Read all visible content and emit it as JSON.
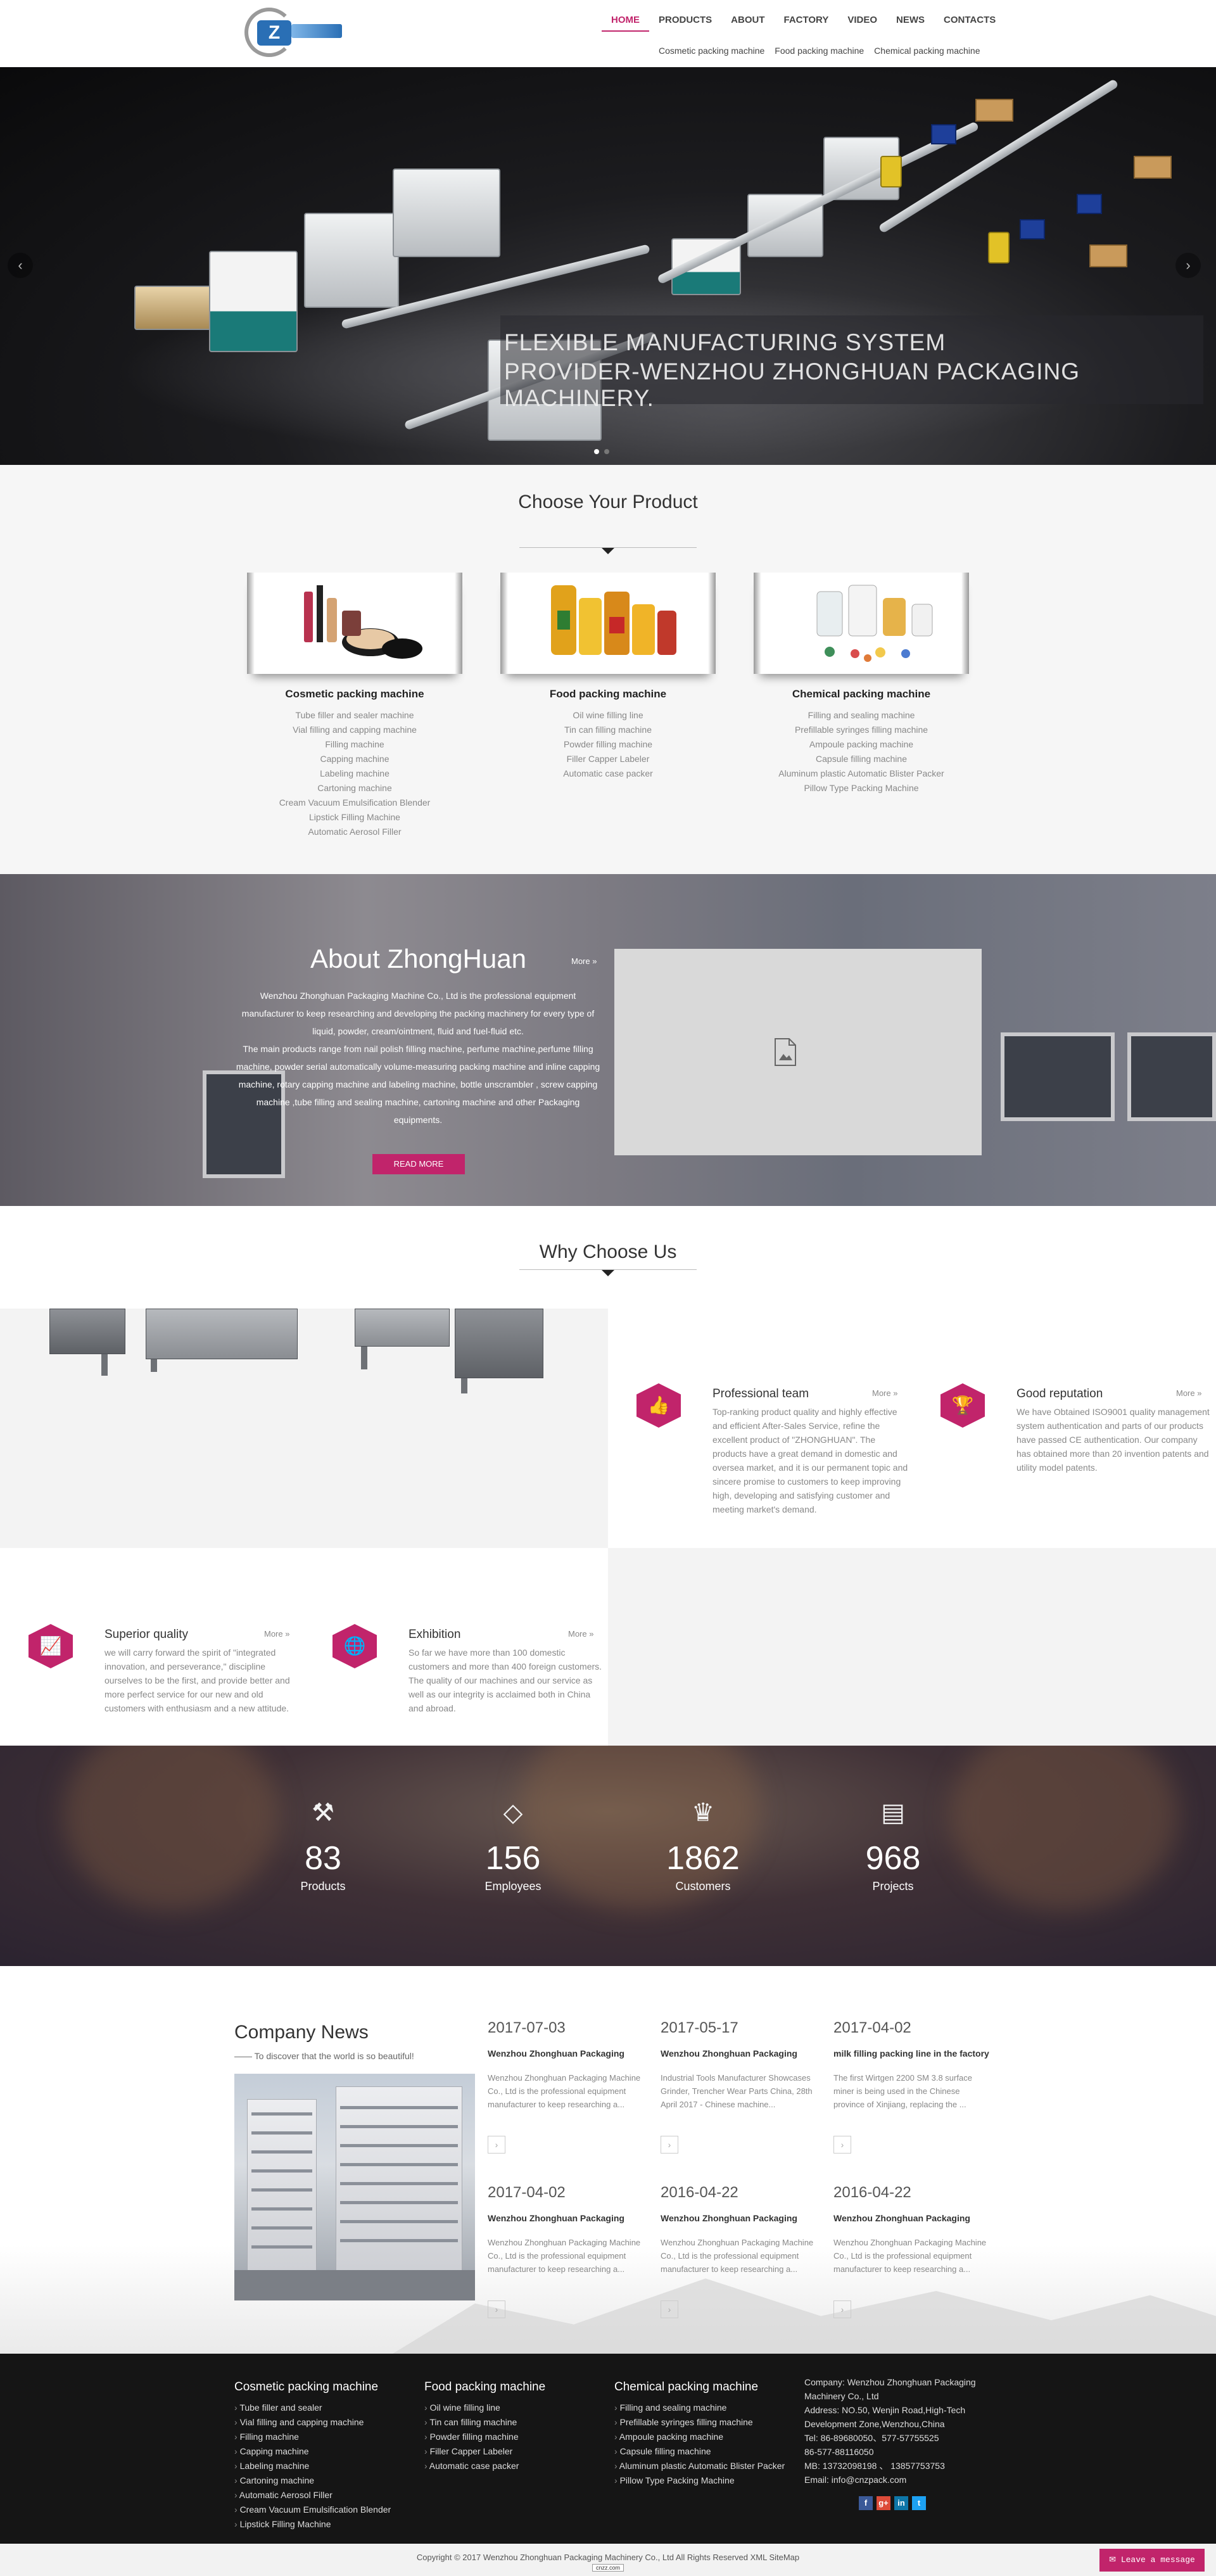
{
  "nav": {
    "items": [
      "HOME",
      "PRODUCTS",
      "ABOUT",
      "FACTORY",
      "VIDEO",
      "NEWS",
      "CONTACTS"
    ],
    "active": "HOME",
    "sub": [
      "Cosmetic packing machine",
      "Food packing machine",
      "Chemical packing machine"
    ]
  },
  "hero": {
    "caption_line1": "FLEXIBLE MANUFACTURING SYSTEM",
    "caption_line2": "PROVIDER-WENZHOU ZHONGHUAN PACKAGING MACHINERY.",
    "prev": "‹",
    "next": "›"
  },
  "choose": {
    "title": "Choose Your Product",
    "products": [
      {
        "name": "Cosmetic packing machine",
        "items": [
          "Tube filler and sealer machine",
          "Vial filling and capping machine",
          "Filling machine",
          "Capping machine",
          "Labeling machine",
          "Cartoning machine",
          "Cream Vacuum Emulsification Blender",
          "Lipstick Filling Machine",
          "Automatic Aerosol Filler"
        ]
      },
      {
        "name": "Food packing machine",
        "items": [
          "Oil wine filling line",
          "Tin can filling machine",
          "Powder filling machine",
          "Filler Capper Labeler",
          "Automatic case packer"
        ]
      },
      {
        "name": "Chemical packing machine",
        "items": [
          "Filling and sealing machine",
          "Prefillable syringes filling machine",
          "Ampoule packing machine",
          "Capsule filling machine",
          "Aluminum plastic Automatic Blister Packer",
          "Pillow Type Packing Machine"
        ]
      }
    ]
  },
  "about": {
    "title": "About ZhongHuan",
    "more": "More »",
    "text1": "Wenzhou Zhonghuan Packaging Machine Co., Ltd is the professional equipment manufacturer to keep researching and developing the packing machinery for every type of liquid, powder, cream/ointment, fluid and fuel-fluid etc.",
    "text2": "The main products range from nail polish filling machine, perfume machine,perfume filling machine, powder serial automatically volume-measuring packing machine and inline capping machine, rotary capping machine and labeling machine, bottle unscrambler , screw capping machine ,tube filling and sealing machine, cartoning machine and other Packaging equipments.",
    "read_more": "READ MORE"
  },
  "why": {
    "title": "Why Choose Us",
    "features": [
      {
        "title": "Professional team",
        "more": "More »",
        "icon": "thumbs-up-icon",
        "glyph": "👍",
        "text": "Top-ranking product quality and highly effective and efficient After-Sales Service, refine the excellent product of \"ZHONGHUAN\". The products have a great demand in domestic and oversea market, and it is our permanent topic and sincere promise to customers to keep improving high, developing and satisfying customer and meeting market's demand."
      },
      {
        "title": "Good reputation",
        "more": "More »",
        "icon": "trophy-icon",
        "glyph": "🏆",
        "text": "We have Obtained ISO9001 quality management system authentication and parts of our products have passed CE authentication. Our company has obtained more than 20 invention patents and utility model patents."
      },
      {
        "title": "Superior quality",
        "more": "More »",
        "icon": "chart-icon",
        "glyph": "📈",
        "text": " we will carry forward the spirit of \"integrated innovation, and perseverance,\" discipline ourselves to be the first, and provide better and more perfect service for our new and old customers with enthusiasm and a new attitude."
      },
      {
        "title": "Exhibition",
        "more": "More »",
        "icon": "globe-icon",
        "glyph": "🌐",
        "text": "So far we have more than 100 domestic customers and more than 400 foreign customers. The quality of our machines and our service as well as our integrity is acclaimed both in China and abroad."
      }
    ]
  },
  "stats": [
    {
      "value": "83",
      "label": "Products",
      "icon": "crane-icon",
      "glyph": "⚒"
    },
    {
      "value": "156",
      "label": "Employees",
      "icon": "diamond-icon",
      "glyph": "◇"
    },
    {
      "value": "1862",
      "label": "Customers",
      "icon": "trophy-icon",
      "glyph": "♛"
    },
    {
      "value": "968",
      "label": "Projects",
      "icon": "document-icon",
      "glyph": "▤"
    }
  ],
  "news": {
    "title": "Company News",
    "subtitle": "—— To discover that the world is so beautiful!",
    "items": [
      {
        "date": "2017-07-03",
        "head": "Wenzhou Zhonghuan Packaging",
        "body": "Wenzhou Zhonghuan Packaging Machine Co., Ltd is the professional equipment manufacturer to keep researching a..."
      },
      {
        "date": "2017-05-17",
        "head": "Wenzhou Zhonghuan Packaging",
        "body": "Industrial Tools Manufacturer Showcases Grinder, Trencher Wear Parts China, 28th April 2017 - Chinese machine..."
      },
      {
        "date": "2017-04-02",
        "head": "milk filling packing line in the factory",
        "body": "The first Wirtgen 2200 SM 3.8 surface miner is being used in the Chinese province of Xinjiang, replacing the ..."
      },
      {
        "date": "2017-04-02",
        "head": "Wenzhou Zhonghuan Packaging",
        "body": "Wenzhou Zhonghuan Packaging Machine Co., Ltd is the professional equipment manufacturer to keep researching a..."
      },
      {
        "date": "2016-04-22",
        "head": "Wenzhou Zhonghuan Packaging",
        "body": "Wenzhou Zhonghuan Packaging Machine Co., Ltd is the professional equipment manufacturer to keep researching a..."
      },
      {
        "date": "2016-04-22",
        "head": "Wenzhou Zhonghuan Packaging",
        "body": "Wenzhou Zhonghuan Packaging Machine Co., Ltd is the professional equipment manufacturer to keep researching a..."
      }
    ],
    "arrow": "›"
  },
  "footer": {
    "cols": [
      {
        "title": "Cosmetic packing machine",
        "items": [
          "Tube filler and sealer",
          "Vial filling and capping machine",
          "Filling machine",
          "Capping machine",
          "Labeling machine",
          "Cartoning machine",
          "Automatic Aerosol Filler",
          "Cream Vacuum Emulsification Blender",
          "Lipstick Filling Machine"
        ]
      },
      {
        "title": "Food packing machine",
        "items": [
          "Oil wine filling line",
          "Tin can filling machine",
          "Powder filling machine",
          "Filler Capper Labeler",
          "Automatic case packer"
        ]
      },
      {
        "title": "Chemical packing machine",
        "items": [
          "Filling and sealing machine",
          "Prefillable syringes filling machine",
          "Ampoule packing machine",
          "Capsule filling machine",
          "Aluminum plastic Automatic Blister Packer",
          "Pillow Type Packing Machine"
        ]
      }
    ],
    "contact": {
      "company": "Company: Wenzhou Zhonghuan Packaging Machinery Co., Ltd",
      "address": "Address: NO.50, Wenjin Road,High-Tech Development Zone,Wenzhou,China",
      "tel": "Tel: 86-89680050、577-57755525",
      "tel2": "86-577-88116050",
      "mb": "MB: 13732098198 、 13857753753",
      "email": "Email: info@cnzpack.com"
    },
    "social": [
      {
        "icon": "facebook-icon",
        "glyph": "f",
        "color": "#3b5998"
      },
      {
        "icon": "google-plus-icon",
        "glyph": "g+",
        "color": "#dd4b39"
      },
      {
        "icon": "linkedin-icon",
        "glyph": "in",
        "color": "#0e76a8"
      },
      {
        "icon": "twitter-icon",
        "glyph": "t",
        "color": "#1da1f2"
      }
    ],
    "copyright": "Copyright © 2017 Wenzhou Zhonghuan Packaging Machinery Co., Ltd All Rights Reserved   XML   SiteMap",
    "cnzz": "cnzz.com",
    "leave_message": "✉ Leave a message"
  }
}
